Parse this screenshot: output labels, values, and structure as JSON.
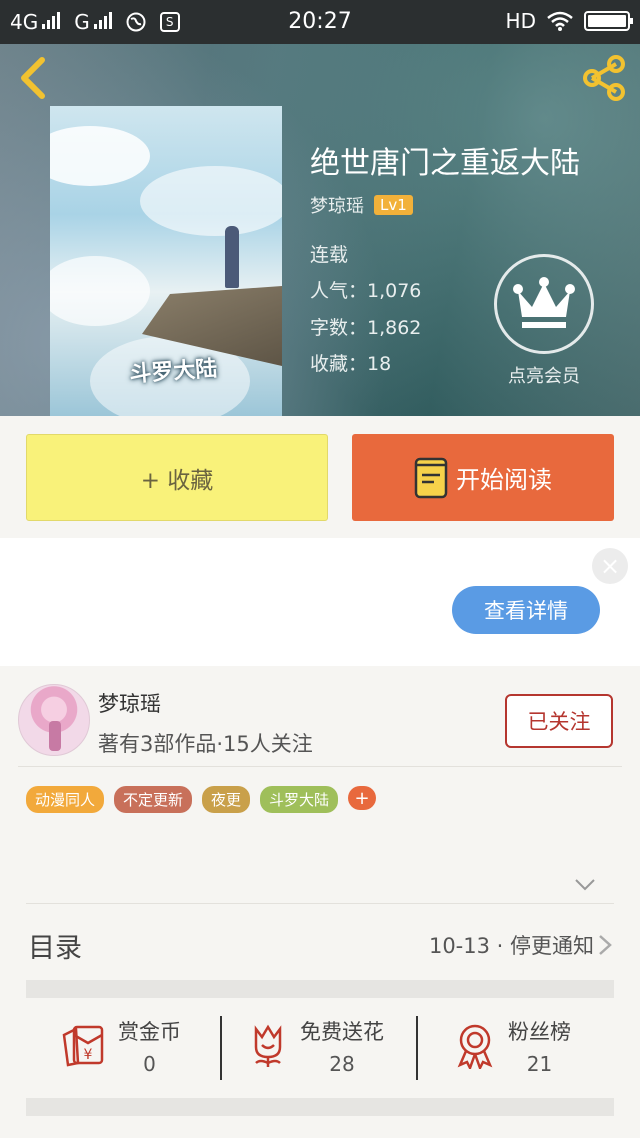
{
  "status_bar": {
    "network1": "4G",
    "network2": "G",
    "time": "20:27",
    "hd": "HD",
    "sim_badge": "S"
  },
  "book": {
    "title": "绝世唐门之重返大陆",
    "author": "梦琼瑶",
    "level": "Lv1",
    "status": "连载",
    "popularity": "人气：1,076",
    "word_count": "字数：1,862",
    "favorites": "收藏：18",
    "cover_text": "斗罗大陆"
  },
  "vip": {
    "label": "点亮会员"
  },
  "actions": {
    "collect_label": "+ 收藏",
    "read_label": "开始阅读"
  },
  "ad": {
    "close_label": "×",
    "detail_label": "查看详情"
  },
  "author_card": {
    "name": "梦琼瑶",
    "summary": "著有3部作品·15人关注",
    "follow_label": "已关注"
  },
  "tags": [
    {
      "label": "动漫同人",
      "color": "#f2a93b"
    },
    {
      "label": "不定更新",
      "color": "#c8705a"
    },
    {
      "label": "夜更",
      "color": "#c9a04a"
    },
    {
      "label": "斗罗大陆",
      "color": "#9fbf5a"
    }
  ],
  "tag_add_label": "+",
  "catalog": {
    "label": "目录",
    "latest": "10-13 · 停更通知"
  },
  "stats": [
    {
      "label": "赏金币",
      "value": "0",
      "icon": "red-envelope-yen-icon"
    },
    {
      "label": "免费送花",
      "value": "28",
      "icon": "flower-icon"
    },
    {
      "label": "粉丝榜",
      "value": "21",
      "icon": "award-ribbon-icon"
    }
  ],
  "colors": {
    "accent_orange": "#e8693d",
    "collect_yellow": "#f9f27a",
    "detail_blue": "#5a9be4",
    "follow_red": "#b5362f",
    "icon_gold": "#f2c230"
  },
  "battery_level": 1.0
}
